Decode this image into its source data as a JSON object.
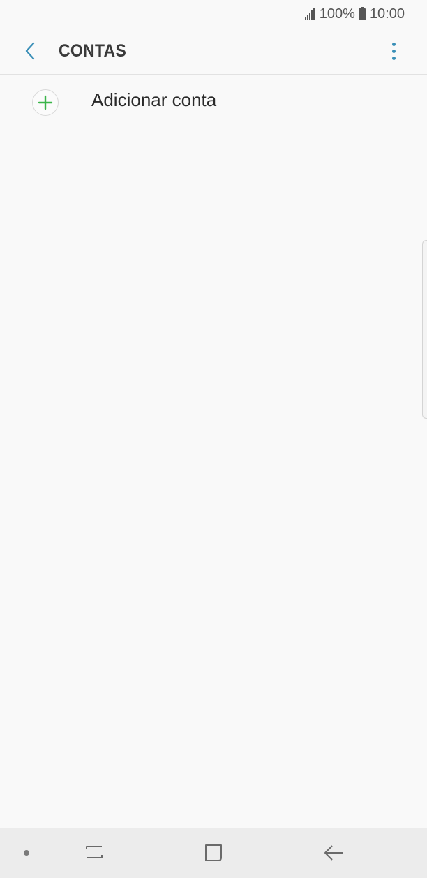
{
  "status_bar": {
    "battery": "100%",
    "time": "10:00"
  },
  "app_bar": {
    "title": "CONTAS"
  },
  "list": {
    "items": [
      {
        "label": "Adicionar conta",
        "icon": "add-icon"
      }
    ]
  },
  "colors": {
    "accent": "#3a8fb7",
    "add_green": "#3bb54a",
    "background": "#f9f9f9",
    "nav_bar": "#ececec"
  },
  "nav_bar": {
    "buttons": [
      "recents-icon",
      "home-icon",
      "back-arrow-icon"
    ]
  }
}
